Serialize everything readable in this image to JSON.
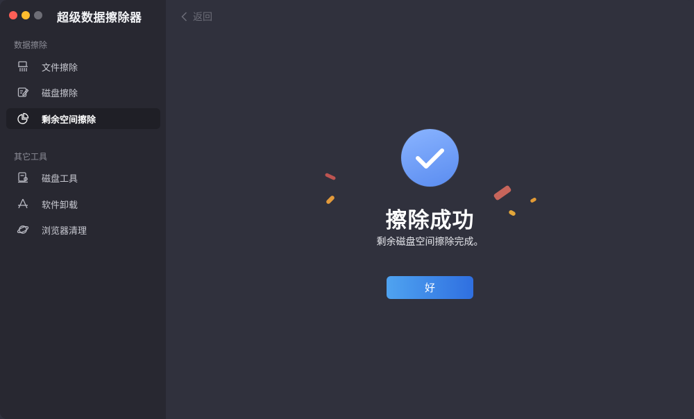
{
  "app": {
    "title": "超级数据擦除器"
  },
  "sidebar": {
    "sections": [
      {
        "title": "数据擦除",
        "items": [
          {
            "label": "文件擦除",
            "icon": "shredder-icon",
            "active": false
          },
          {
            "label": "磁盘擦除",
            "icon": "disk-edit-icon",
            "active": false
          },
          {
            "label": "剩余空间擦除",
            "icon": "pie-chart-icon",
            "active": true
          }
        ]
      },
      {
        "title": "其它工具",
        "items": [
          {
            "label": "磁盘工具",
            "icon": "disk-tool-icon",
            "active": false
          },
          {
            "label": "软件卸载",
            "icon": "app-store-icon",
            "active": false
          },
          {
            "label": "浏览器清理",
            "icon": "planet-icon",
            "active": false
          }
        ]
      }
    ]
  },
  "toolbar": {
    "back_label": "返回"
  },
  "result": {
    "title": "擦除成功",
    "subtitle": "剩余磁盘空间擦除完成。",
    "ok_label": "好"
  },
  "colors": {
    "accent_start": "#4fa3f0",
    "accent_end": "#2f6fe0",
    "check_circle": "#6f9ef8",
    "sidebar_bg": "#282831",
    "main_bg": "#30313d"
  }
}
